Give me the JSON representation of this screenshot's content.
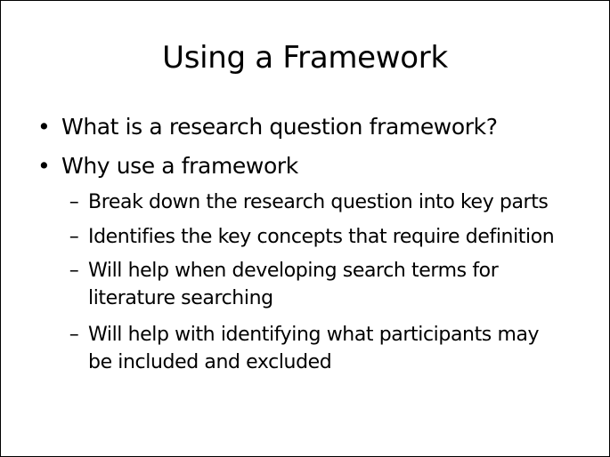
{
  "slide": {
    "title": "Using a Framework",
    "bullets": [
      {
        "marker": "•",
        "text": "What is a research question framework?"
      },
      {
        "marker": "•",
        "text": "Why use a framework"
      }
    ],
    "sub_bullets": [
      {
        "marker": "–",
        "line1": "Break down the research question into key parts",
        "line2": ""
      },
      {
        "marker": "–",
        "line1": "Identifies the key concepts that require definition",
        "line2": ""
      },
      {
        "marker": "–",
        "line1": "Will help when developing search terms for",
        "line2": "literature searching"
      },
      {
        "marker": "–",
        "line1": "Will help with identifying what participants may",
        "line2": "be included and excluded"
      }
    ]
  }
}
